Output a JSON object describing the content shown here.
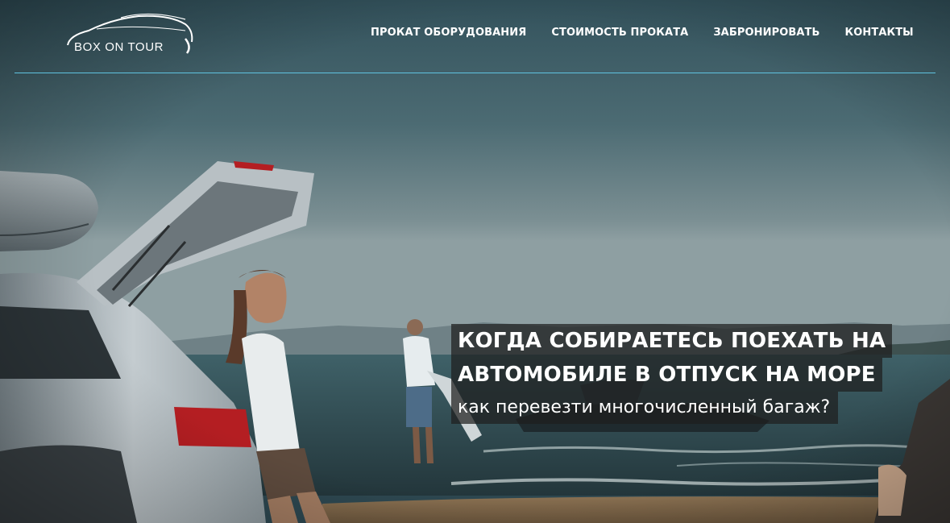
{
  "brand": {
    "logo_text": "BOX ON TOUR"
  },
  "nav": {
    "items": [
      {
        "label": "ПРОКАТ ОБОРУДОВАНИЯ"
      },
      {
        "label": "СТОИМОСТЬ ПРОКАТА"
      },
      {
        "label": "ЗАБРОНИРОВАТЬ"
      },
      {
        "label": "КОНТАКТЫ"
      }
    ]
  },
  "hero": {
    "line1": "КОГДА СОБИРАЕТЕСЬ ПОЕХАТЬ НА",
    "line2": "АВТОМОБИЛЕ В ОТПУСК НА МОРЕ",
    "line3": "как перевезти многочисленный багаж?"
  },
  "colors": {
    "nav_text": "#ffffff",
    "header_rule": "#5fc3e0",
    "caption_bg": "#1e1e1e"
  }
}
